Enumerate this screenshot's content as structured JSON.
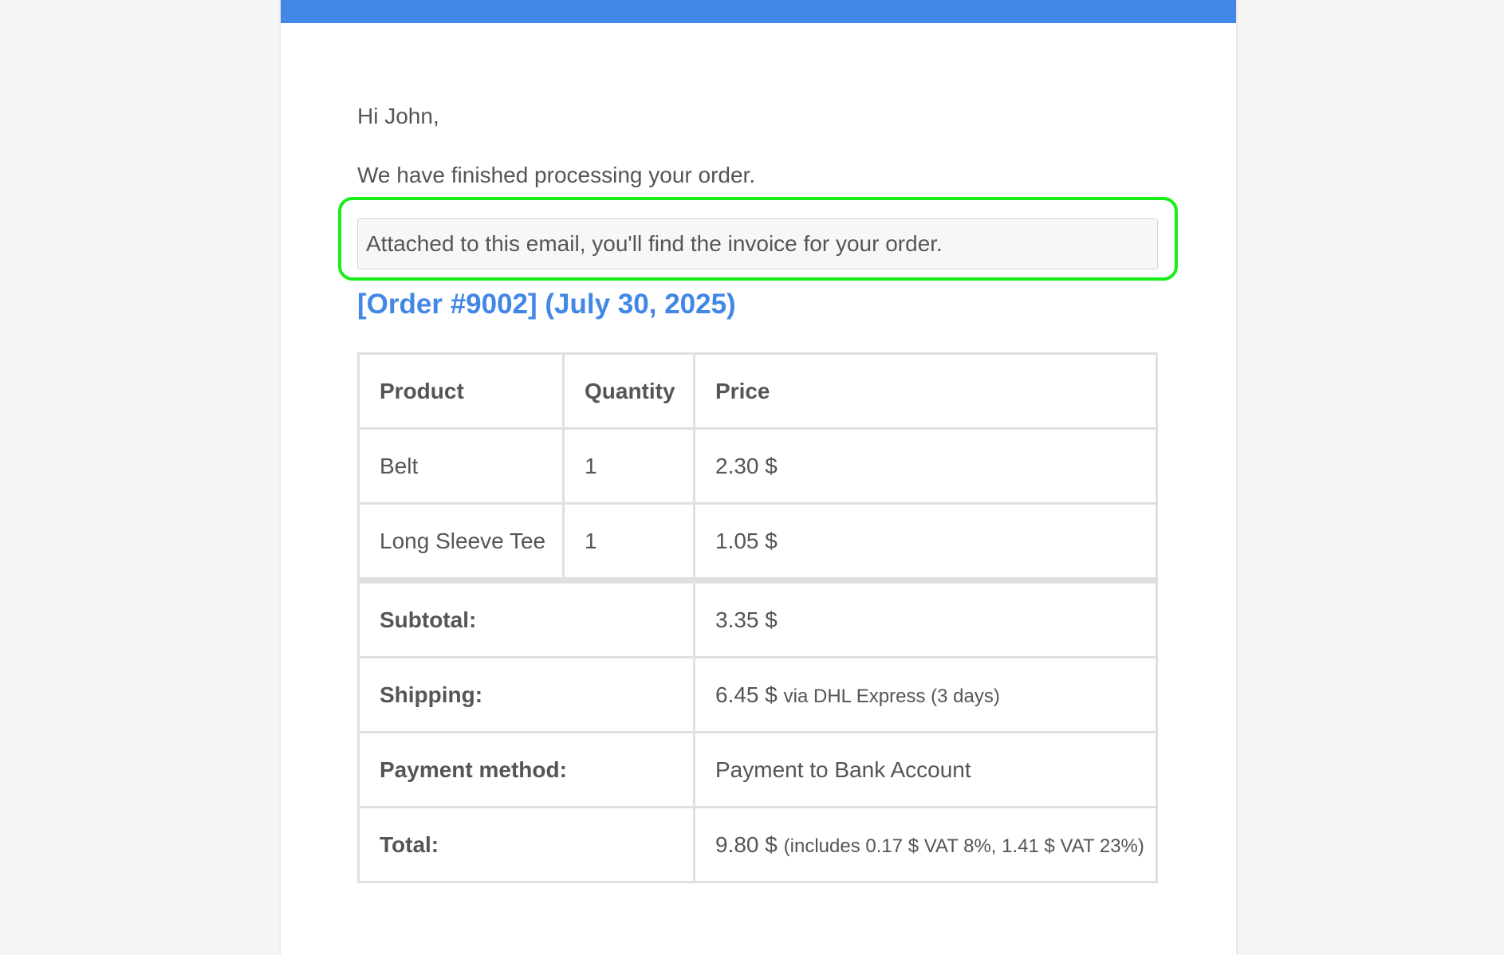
{
  "colors": {
    "header_bar": "#4287e6",
    "order_title": "#4287e6",
    "highlight_outline": "#18ef18"
  },
  "email": {
    "greeting": "Hi John,",
    "intro": "We have finished processing your order.",
    "note": "Attached to this email, you'll find the invoice for your order.",
    "order_title": "[Order #9002] (July 30, 2025)"
  },
  "table": {
    "headers": {
      "product": "Product",
      "quantity": "Quantity",
      "price": "Price"
    },
    "items": [
      {
        "product": "Belt",
        "quantity": "1",
        "price": "2.30 $"
      },
      {
        "product": "Long Sleeve Tee",
        "quantity": "1",
        "price": "1.05 $"
      }
    ],
    "totals": {
      "subtotal_label": "Subtotal:",
      "subtotal_value": "3.35 $",
      "shipping_label": "Shipping:",
      "shipping_value": "6.45 $",
      "shipping_note": "via DHL Express (3 days)",
      "payment_label": "Payment method:",
      "payment_value": "Payment to Bank Account",
      "total_label": "Total:",
      "total_value": "9.80 $",
      "total_note": "(includes 0.17 $ VAT 8%, 1.41 $ VAT 23%)"
    }
  }
}
